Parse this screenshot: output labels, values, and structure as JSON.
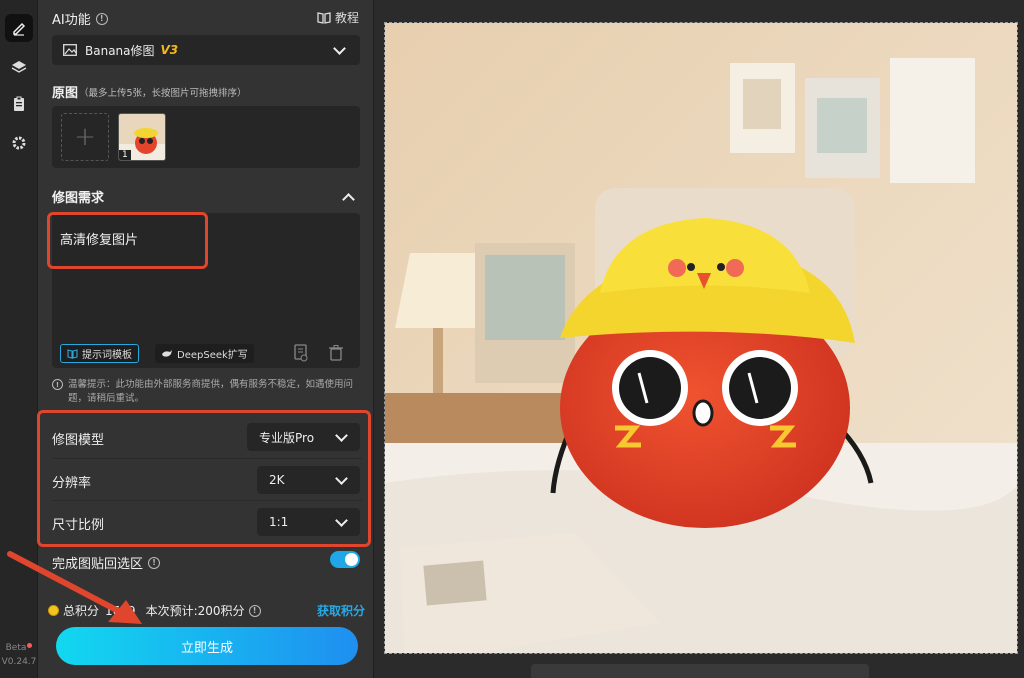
{
  "sidebar": {
    "icons": [
      "edit-icon",
      "layers-icon",
      "clipboard-icon",
      "gear-icon"
    ],
    "beta_label": "Beta",
    "version": "V0.24.7"
  },
  "panel": {
    "ai_function_title": "AI功能",
    "tutorial_label": "教程",
    "model_select": {
      "name": "Banana修图",
      "version": "V3"
    },
    "original_title": "原图",
    "original_hint": "（最多上传5张，长按图片可拖拽排序）",
    "thumb_index": "1",
    "request_title": "修图需求",
    "prompt_text": "高清修复图片",
    "prompt_template_label": "提示词模板",
    "deepseek_label": "DeepSeek扩写",
    "tip_text": "温馨提示：此功能由外部服务商提供，偶有服务不稳定，如遇使用问题，请稍后重试。",
    "settings": [
      {
        "label": "修图模型",
        "value": "专业版Pro"
      },
      {
        "label": "分辨率",
        "value": "2K"
      },
      {
        "label": "尺寸比例",
        "value": "1:1"
      }
    ],
    "paste_back_label": "完成图贴回选区",
    "paste_back_enabled": true,
    "points_label": "总积分",
    "points_value": "1679",
    "estimate_label": "本次预计:200积分",
    "get_points_label": "获取积分",
    "generate_label": "立即生成"
  },
  "colors": {
    "accent": "#1fa7e8",
    "highlight": "#e0452d",
    "version_tag": "#f5b81c"
  }
}
